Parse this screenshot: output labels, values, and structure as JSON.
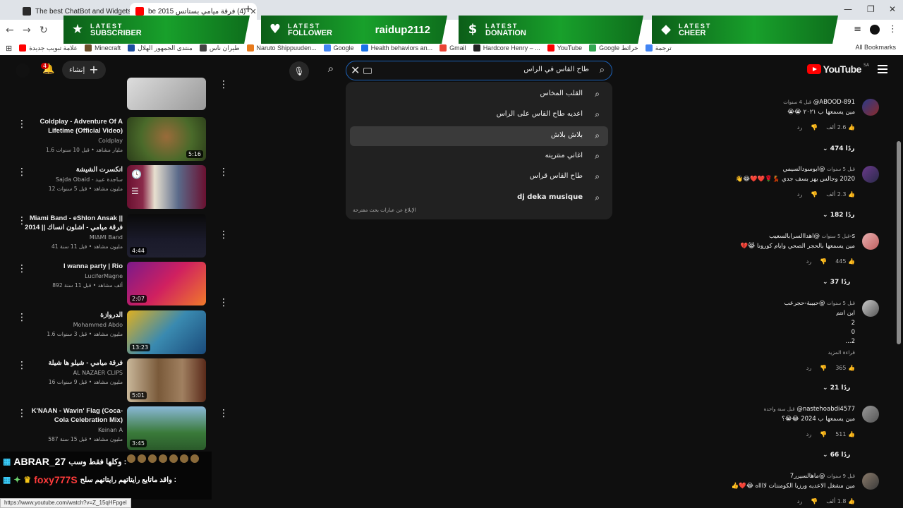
{
  "browser": {
    "tabs": [
      {
        "title": "The best ChatBot and Widgets"
      },
      {
        "title": "(4) فرقة ميامي بستاتس 2015 be"
      }
    ],
    "bookmarks": [
      "علامة تبويب جديدة",
      "Minecraft",
      "منتدى الجمهور الهلال",
      "طيران ناس",
      "Naruto Shippuuden...",
      "Google",
      "Health behaviors an...",
      "Gmail",
      "Hardcore Henry – ...",
      "YouTube",
      "Google خرائط",
      "ترجمة"
    ],
    "all_bookmarks": "All Bookmarks",
    "status_url": "https://www.youtube.com/watch?v=Z_15qHFpgel"
  },
  "alerts": [
    {
      "line1": "LATEST",
      "line2": "SUBSCRIBER",
      "name": "",
      "icon": "★"
    },
    {
      "line1": "LATEST",
      "line2": "FOLLOWER",
      "name": "raidup2112",
      "icon": "♥"
    },
    {
      "line1": "LATEST",
      "line2": "DONATION",
      "name": "",
      "icon": "$"
    },
    {
      "line1": "LATEST",
      "line2": "CHEER",
      "name": "",
      "icon": "◆"
    }
  ],
  "youtube": {
    "logo": "YouTube",
    "logo_country": "SA",
    "search_query": "طاح القاس في الراس",
    "create_label": "إنشاء",
    "notif_count": "4",
    "suggestions": [
      {
        "text": "القلب المخاس",
        "bold": false
      },
      {
        "text": "اعديه طاح القاس على الراس",
        "bold": false
      },
      {
        "text": "بلاش بلاش",
        "bold": false
      },
      {
        "text": "اغاني منترينه",
        "bold": false
      },
      {
        "text": "طاح القاس قراس",
        "bold": false
      },
      {
        "text": "dj deka musique",
        "bold": true
      }
    ],
    "report_label": "الإبلاغ عن عبارات بحث مقترحة"
  },
  "videos": [
    {
      "title": "Coldplay - Adventure Of A Lifetime (Official Video)",
      "channel": "Coldplay",
      "meta": "1.6 مليار مشاهد • قبل 10 سنوات",
      "duration": "5:16"
    },
    {
      "title": "انكسرت الشيشة",
      "channel": "Sajda Obaid - ساجدة عبيد",
      "meta": "12 مليون مشاهد • قبل 5 سنوات",
      "duration": ""
    },
    {
      "title": "Miami Band - eShlon Ansak || فرقة ميامي - اشلون انساك || 2014",
      "channel": "MIAMI Band",
      "meta": "41 مليون مشاهد • قبل 11 سنة",
      "duration": "4:44"
    },
    {
      "title": "I wanna party | Rio",
      "channel": "LuciferMagne",
      "meta": "892 ألف مشاهد • قبل 11 سنة",
      "duration": "2:07"
    },
    {
      "title": "الدروازة",
      "channel": "Mohammed Abdo",
      "meta": "1.6 مليون مشاهد • قبل 3 سنوات",
      "duration": "13:23"
    },
    {
      "title": "فرقة ميامي - شيلو ها شيلة",
      "channel": "AL NAZAER CLIPS",
      "meta": "16 مليون مشاهد • قبل 9 سنوات",
      "duration": "5:01"
    },
    {
      "title": "K'NAAN - Wavin' Flag (Coca-Cola Celebration Mix)",
      "channel": "Keinan A",
      "meta": "587 مليون مشاهد • قبل 15 سنة",
      "duration": "3:45"
    }
  ],
  "comments": [
    {
      "author": "@ABOOD-891",
      "when": "قبل 4 سنوات",
      "text": "مين يسمعها ب ٢٠٢١ 😭😭",
      "likes": "2.6 ألف",
      "reply": "رد",
      "replies": "474 ردًا"
    },
    {
      "author": "@ابوسودالسيمي",
      "when": "قبل 5 سنوات",
      "text": "2020 وجالس يهز بسف جدي 💃🌹❤️❤️😂👋",
      "likes": "2.3 ألف",
      "reply": "رد",
      "replies": "182 ردًا"
    },
    {
      "author": "@اهداالسرابالسعيب-s",
      "when": "قبل 5 سنوات",
      "text": "مين يسمعها بالحجر الصحي وايام كورونا 😹💔",
      "likes": "445",
      "reply": "رد",
      "replies": "37 ردًا"
    },
    {
      "author": "@حبيبة-حجرعب",
      "when": "قبل 5 سنوات",
      "text": "اين انتم",
      "extra": [
        "2",
        "0",
        "2..."
      ],
      "more": "قراءة المزيد",
      "likes": "365",
      "reply": "رد",
      "replies": "21 ردًا"
    },
    {
      "author": "@nastehoabdi4577",
      "when": "قبل سنة واحدة",
      "text": "مين يسمعها ب 2024 😂😭؟",
      "likes": "511",
      "reply": "رد",
      "replies": "66 ردًا"
    },
    {
      "author": "@ماهالسيرر7",
      "when": "قبل 9 سنوات",
      "text": "مين مشغل الاعديه ورزيا الكومنتات لااااه 😂❤️👍",
      "likes": "1.8 ألف",
      "reply": "رد",
      "replies": ""
    }
  ],
  "chat": [
    {
      "user": "ABRAR_27",
      "msg": ": وكلها فقط وسب"
    },
    {
      "user": "foxy777S",
      "msg": ": واقد ماتايع رايتاتهم رايتاتهم سلح"
    }
  ]
}
